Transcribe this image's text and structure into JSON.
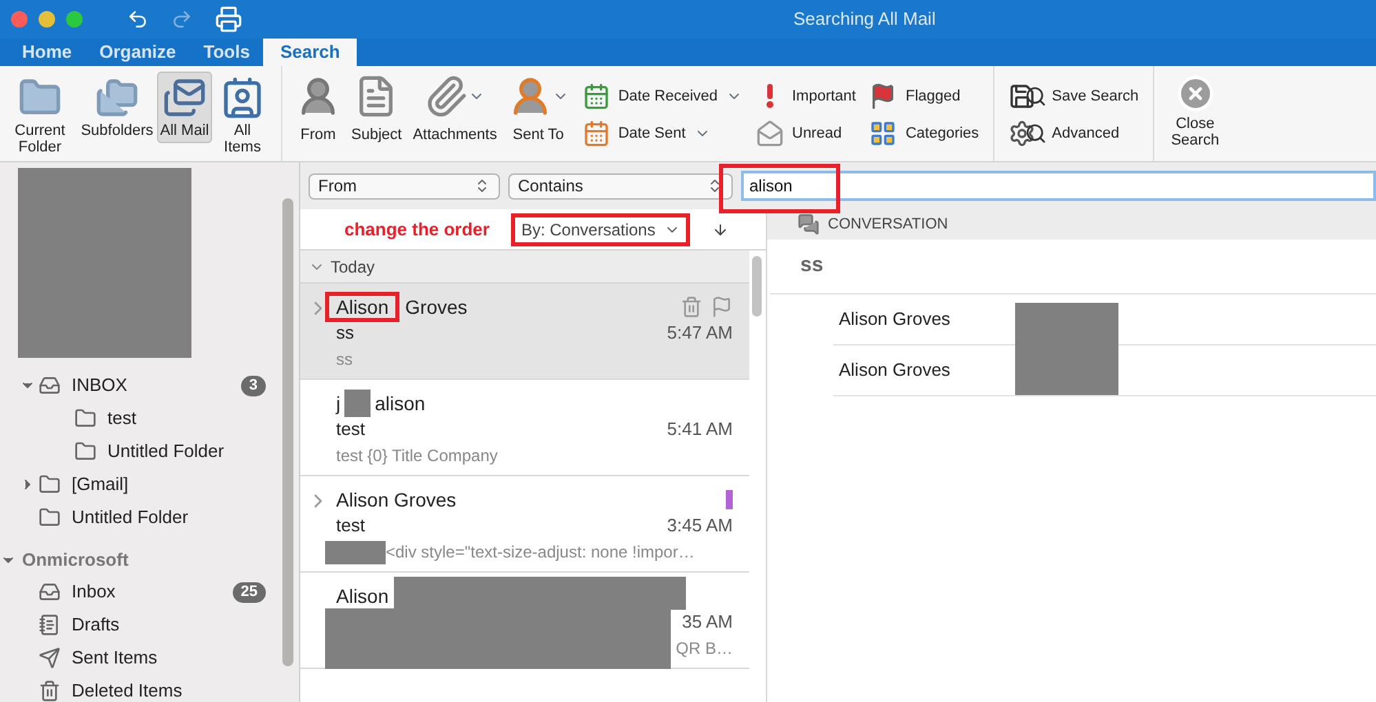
{
  "window": {
    "title": "Searching All Mail"
  },
  "tabs": [
    {
      "label": "Home",
      "selected": false
    },
    {
      "label": "Organize",
      "selected": false
    },
    {
      "label": "Tools",
      "selected": false
    },
    {
      "label": "Search",
      "selected": true
    }
  ],
  "ribbon": {
    "scope_buttons": [
      {
        "label": "Current Folder",
        "selected": false
      },
      {
        "label": "Subfolders",
        "selected": false
      },
      {
        "label": "All Mail",
        "selected": true
      },
      {
        "label": "All Items",
        "selected": false
      }
    ],
    "refine_buttons": [
      {
        "label": "From",
        "dropdown": false
      },
      {
        "label": "Subject",
        "dropdown": false
      },
      {
        "label": "Attachments",
        "dropdown": true
      },
      {
        "label": "Sent To",
        "dropdown": true
      }
    ],
    "filter_buttons": [
      {
        "label": "Date Received",
        "dropdown": true
      },
      {
        "label": "Date Sent",
        "dropdown": true
      },
      {
        "label": "Important",
        "dropdown": false
      },
      {
        "label": "Unread",
        "dropdown": false
      },
      {
        "label": "Flagged",
        "dropdown": false
      },
      {
        "label": "Categories",
        "dropdown": false
      }
    ],
    "search_buttons": [
      {
        "label": "Save Search"
      },
      {
        "label": "Advanced"
      }
    ],
    "close_button": {
      "label": "Close Search"
    }
  },
  "sidebar": {
    "accounts": [
      {
        "folders": [
          {
            "name": "INBOX",
            "kind": "inbox",
            "count": "3",
            "expanded": true,
            "children": [
              {
                "name": "test",
                "kind": "folder"
              },
              {
                "name": "Untitled Folder",
                "kind": "folder"
              }
            ]
          },
          {
            "name": "[Gmail]",
            "kind": "folder",
            "expanded": false
          },
          {
            "name": "Untitled Folder",
            "kind": "folder"
          }
        ]
      },
      {
        "name": "Onmicrosoft",
        "expanded": true,
        "folders": [
          {
            "name": "Inbox",
            "kind": "inbox",
            "count": "25"
          },
          {
            "name": "Drafts",
            "kind": "drafts"
          },
          {
            "name": "Sent Items",
            "kind": "sent"
          },
          {
            "name": "Deleted Items",
            "kind": "trash"
          }
        ]
      }
    ]
  },
  "search": {
    "field": "From",
    "operator": "Contains",
    "query": "alison"
  },
  "sort": {
    "annotation": "change the order",
    "label": "By: Conversations"
  },
  "message_list": {
    "group": "Today",
    "expanded": true,
    "messages": [
      {
        "sender": [
          {
            "text": "Alison",
            "kind": "highlighted"
          },
          {
            "text": "Groves",
            "kind": "plain"
          }
        ],
        "subject": "ss",
        "time": "5:47 AM",
        "preview": "ss",
        "selected": true,
        "thread": true
      },
      {
        "sender": [
          {
            "text": "j",
            "kind": "plain"
          },
          {
            "kind": "redacted"
          },
          {
            "text": "alison",
            "kind": "plain"
          }
        ],
        "subject": "test",
        "time": "5:41 AM",
        "preview": "test {0} Title Company",
        "selected": false,
        "thread": false
      },
      {
        "sender": [
          {
            "text": "Alison Groves",
            "kind": "plain"
          }
        ],
        "subject": "test",
        "time": "3:45 AM",
        "preview": "<div style=\"text-size-adjust: none !impor…",
        "preview_redacted": true,
        "color": "#b463d6",
        "selected": false,
        "thread": true
      },
      {
        "sender": [
          {
            "text": "Alison",
            "kind": "plain"
          }
        ],
        "time": "35 AM",
        "preview": "QR B…",
        "redacted": true,
        "selected": false,
        "thread": false
      }
    ]
  },
  "reading_pane": {
    "header": "CONVERSATION",
    "subject": "ss",
    "participants": [
      "Alison Groves",
      "Alison Groves"
    ]
  }
}
